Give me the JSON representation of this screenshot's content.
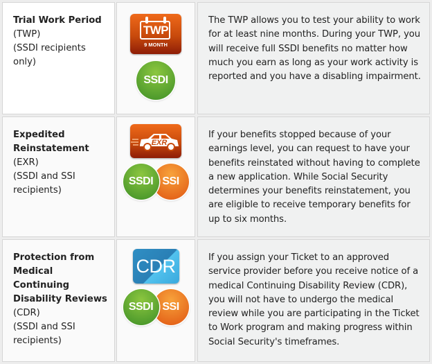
{
  "rows": [
    {
      "title": "Trial Work Period",
      "abbr": "(TWP)",
      "eligibility": "(SSDI recipients only)",
      "icon": {
        "name": "twp-calendar-icon",
        "label": "TWP",
        "sublabel": "9 MONTH"
      },
      "badges": [
        "SSDI"
      ],
      "description": "The TWP allows you to test your ability to work for at least nine months. During your TWP, you will receive full SSDI benefits no matter how much you earn as long as your work activity is reported and you have a disabling impairment."
    },
    {
      "title": "Expedited Reinstatement",
      "abbr": "(EXR)",
      "eligibility": "(SSDI and SSI recipients)",
      "icon": {
        "name": "exr-car-icon",
        "label": "EXR"
      },
      "badges": [
        "SSDI",
        "SSI"
      ],
      "description": "If your benefits stopped because of your earnings level, you can request to have your benefits reinstated without having to complete a new application. While Social Security determines your benefits reinstatement, you are eligible to receive temporary benefits for up to six months."
    },
    {
      "title": "Protection from Medical Continuing Disability Reviews",
      "abbr": "(CDR)",
      "eligibility": "(SSDI and SSI recipients)",
      "icon": {
        "name": "cdr-icon",
        "label": "CDR"
      },
      "badges": [
        "SSDI",
        "SSI"
      ],
      "description": "If you assign your Ticket to an approved service provider before you receive notice of a medical Continuing Disability Review (CDR), you will not have to undergo the medical review while you are participating in the Ticket to Work program and making progress within Social Security's timeframes."
    }
  ],
  "colors": {
    "ssdi_green": "#5ba632",
    "ssi_orange": "#ee7b22",
    "icon_orange": "#d9540f",
    "icon_blue": "#2f8fc4",
    "description_bg": "#f0f1f1"
  }
}
